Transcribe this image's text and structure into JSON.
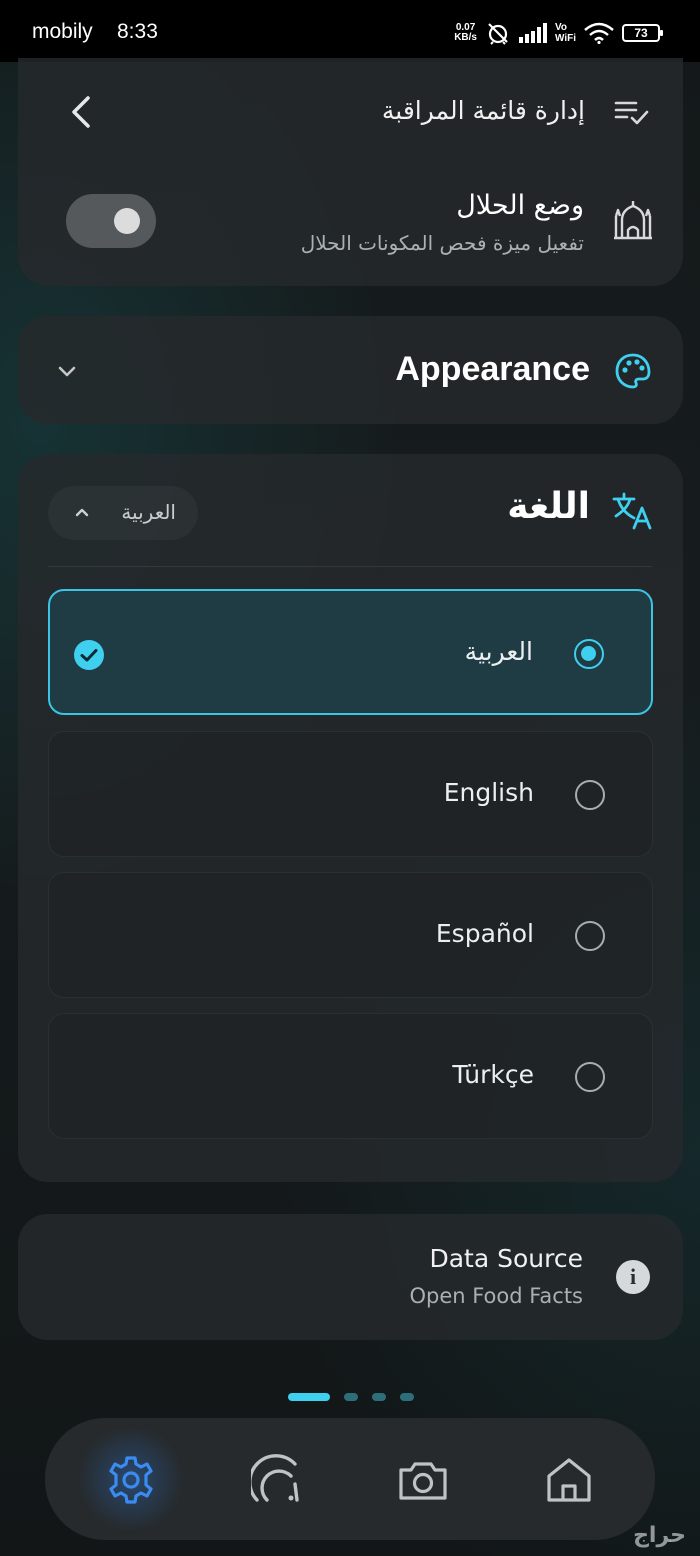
{
  "status_bar": {
    "carrier": "mobily",
    "time": "8:33",
    "net_speed_value": "0.07",
    "net_speed_unit": "KB/s",
    "volte_top": "Vo",
    "volte_bottom": "WiFi",
    "battery": "73"
  },
  "header": {
    "title": "إدارة قائمة المراقبة",
    "back_icon": "chevron-left-icon",
    "list_icon": "playlist-check-icon"
  },
  "halal_mode": {
    "title": "وضع الحلال",
    "subtitle": "تفعيل ميزة فحص المكونات الحلال",
    "enabled": false,
    "icon": "mosque-icon"
  },
  "appearance": {
    "title": "Appearance",
    "icon": "palette-icon",
    "expanded": false
  },
  "language": {
    "title": "اللغة",
    "icon": "translate-icon",
    "selected_label": "العربية",
    "expanded": true,
    "options": [
      {
        "label": "العربية",
        "selected": true
      },
      {
        "label": "English",
        "selected": false
      },
      {
        "label": "Español",
        "selected": false
      },
      {
        "label": "Türkçe",
        "selected": false
      }
    ]
  },
  "data_source": {
    "title": "Data Source",
    "subtitle": "Open Food Facts",
    "icon": "info-icon"
  },
  "pager": {
    "count": 4,
    "active_index": 0
  },
  "bottom_nav": [
    {
      "name": "settings",
      "icon": "gear-icon",
      "active": true
    },
    {
      "name": "gauge",
      "icon": "gauge-icon",
      "active": false
    },
    {
      "name": "camera",
      "icon": "camera-icon",
      "active": false
    },
    {
      "name": "home",
      "icon": "home-icon",
      "active": false
    }
  ],
  "colors": {
    "accent": "#3fd0f0",
    "nav_active": "#3a8cf0",
    "card_bg": "#262a2c"
  },
  "watermark": "حراج"
}
